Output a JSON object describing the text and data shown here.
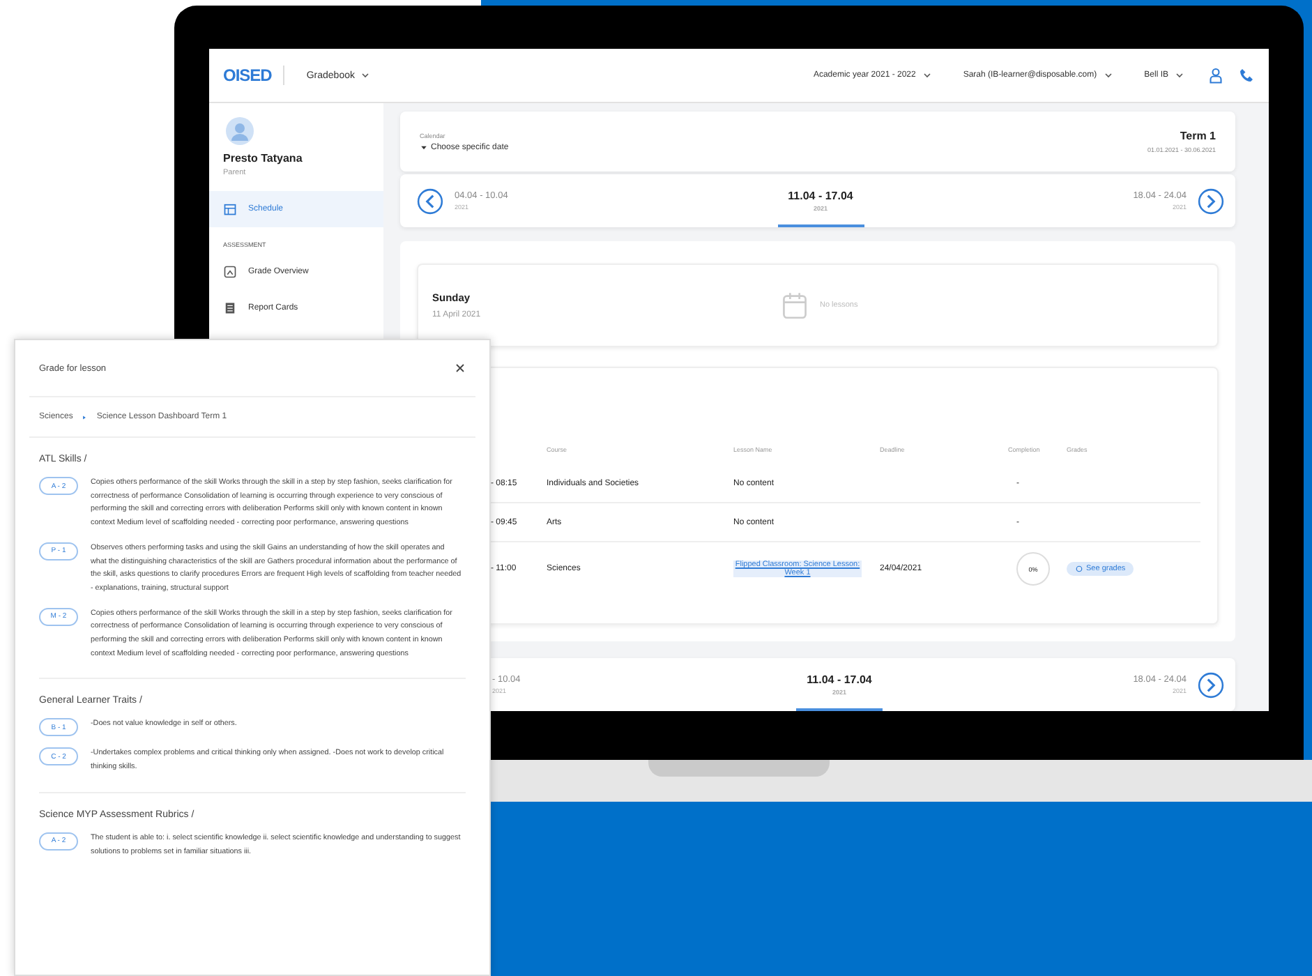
{
  "header": {
    "logo": "OISED",
    "nav": "Gradebook",
    "academic_year": "Academic year 2021 - 2022",
    "account": "Sarah (IB-learner@disposable.com)",
    "school": "Bell IB"
  },
  "sidebar": {
    "user_name": "Presto Tatyana",
    "user_role": "Parent",
    "items": [
      {
        "kind": "item",
        "label": "Schedule",
        "selected": true
      },
      {
        "kind": "heading",
        "label": "ASSESSMENT"
      },
      {
        "kind": "item",
        "label": "Grade Overview",
        "selected": false
      },
      {
        "kind": "item",
        "label": "Report Cards",
        "selected": false
      }
    ]
  },
  "calendar": {
    "label": "Calendar",
    "picker": "Choose specific date",
    "term": "Term 1",
    "term_dates": "01.01.2021 - 30.06.2021"
  },
  "week_bar": [
    {
      "range": "04.04 - 10.04",
      "year": "2021",
      "selected": false
    },
    {
      "range": "11.04 - 17.04",
      "year": "2021",
      "selected": true
    },
    {
      "range": "18.04 - 24.04",
      "year": "2021",
      "selected": false
    }
  ],
  "day": {
    "weekday": "Sunday",
    "date": "11 April 2021",
    "empty": "No lessons"
  },
  "lessons": {
    "columns": [
      "Course",
      "Lesson Name",
      "Deadline",
      "Completion",
      "Grades"
    ],
    "rows": [
      {
        "time": "- 08:15",
        "course": "Individuals and Societies",
        "lesson": "No content",
        "lesson_link": false,
        "deadline": "",
        "completion": "-",
        "grades": ""
      },
      {
        "time": "- 09:45",
        "course": "Arts",
        "lesson": "No content",
        "lesson_link": false,
        "deadline": "",
        "completion": "-",
        "grades": ""
      },
      {
        "time": "- 11:00",
        "course": "Sciences",
        "lesson": "Flipped Classroom: Science Lesson: Week 1",
        "lesson_link": true,
        "deadline": "24/04/2021",
        "completion": "0%",
        "grades": "See grades"
      }
    ]
  },
  "week_bar_bottom": [
    {
      "range": "- 10.04",
      "year": "2021",
      "selected": false
    },
    {
      "range": "11.04 - 17.04",
      "year": "2021",
      "selected": true
    },
    {
      "range": "18.04 - 24.04",
      "year": "2021",
      "selected": false
    }
  ],
  "grade_panel": {
    "title": "Grade for lesson",
    "breadcrumb": [
      "Sciences",
      "Science Lesson Dashboard Term 1"
    ],
    "sections": [
      {
        "title": "ATL Skills /",
        "grades": [
          {
            "badge": "A - 2",
            "text": "Copies others performance of the skill Works through the skill in a step by step fashion, seeks clarification for correctness of performance Consolidation of learning is occurring through experience to very conscious of performing the skill and correcting errors with deliberation Performs skill only with known content in known context Medium level of scaffolding needed - correcting poor performance, answering questions"
          },
          {
            "badge": "P - 1",
            "text": "Observes others performing tasks and using the skill Gains an understanding of how the skill operates and what the distinguishing characteristics of the skill are Gathers procedural information about the performance of the skill, asks questions to clarify procedures Errors are frequent High levels of scaffolding from teacher needed - explanations, training, structural support"
          },
          {
            "badge": "M - 2",
            "text": "Copies others performance of the skill Works through the skill in a step by step fashion, seeks clarification for correctness of performance Consolidation of learning is occurring through experience to very conscious of performing the skill and correcting errors with deliberation Performs skill only with known content in known context Medium level of scaffolding needed - correcting poor performance, answering questions"
          }
        ]
      },
      {
        "title": "General Learner Traits /",
        "grades": [
          {
            "badge": "B - 1",
            "text": "-Does not value knowledge in self or others."
          },
          {
            "badge": "C - 2",
            "text": "-Undertakes complex problems and critical thinking only when assigned. -Does not work to develop critical thinking skills."
          }
        ]
      },
      {
        "title": "Science MYP Assessment Rubrics /",
        "grades": [
          {
            "badge": "A - 2",
            "text": "The student is able to: i. select scientific knowledge ii. select scientific knowledge and understanding to suggest solutions to problems set in familiar situations iii."
          }
        ]
      }
    ]
  }
}
